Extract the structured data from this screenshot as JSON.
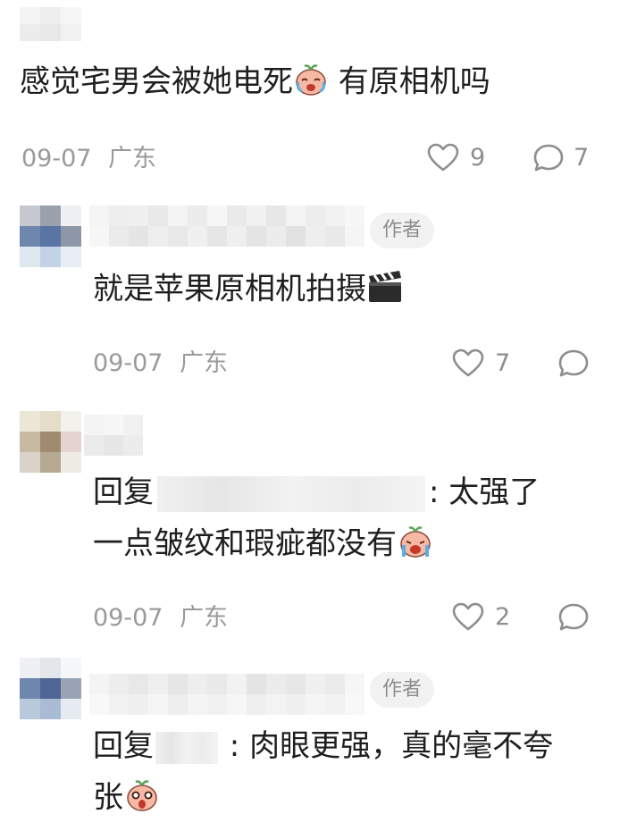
{
  "comments": [
    {
      "text_main": "感觉宅男会被她电死",
      "text_after": " 有原相机吗",
      "emoji": "cry-laugh-emoji",
      "date": "09-07",
      "location": "广东",
      "likes": "9",
      "replies": "7"
    },
    {
      "badge": "作者",
      "text_main": "就是苹果原相机拍摄",
      "emoji": "clapperboard-emoji",
      "date": "09-07",
      "location": "广东",
      "likes": "7"
    },
    {
      "reply_prefix": "回复",
      "reply_suffix": ": 太强了",
      "line2": "一点皱纹和瑕疵都没有",
      "emoji": "sob-emoji",
      "date": "09-07",
      "location": "广东",
      "likes": "2"
    },
    {
      "badge": "作者",
      "reply_prefix": "回复",
      "reply_suffix": " : 肉眼更强，真的毫不夸",
      "line2": "张",
      "emoji": "shocked-emoji"
    }
  ]
}
